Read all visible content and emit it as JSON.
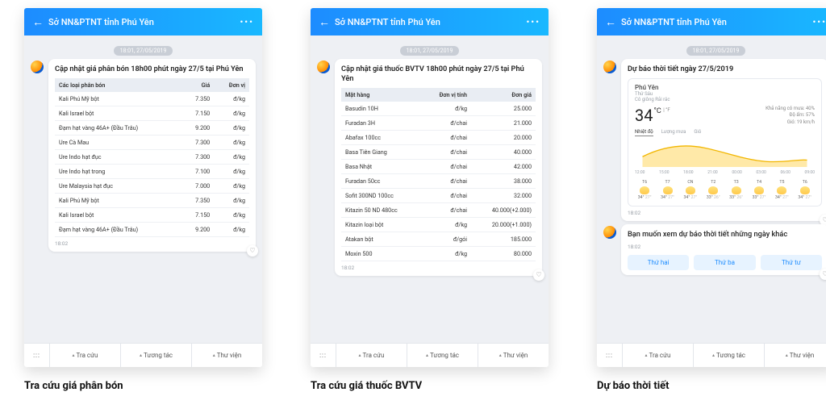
{
  "date_chip": "18:01, 27/05/2019",
  "header_title": "Sở NN&PTNT tỉnh Phú Yên",
  "bottom": {
    "kbd": ":::",
    "t1": "Tra cứu",
    "t2": "Tương tác",
    "t3": "Thư viện"
  },
  "p1": {
    "caption": "Tra cứu giá phân bón",
    "title": "Cập nhật giá phân bón 18h00 phút ngày 27/5 tại Phú Yên",
    "time": "18:02",
    "cols": [
      "Các loại phân bón",
      "Giá",
      "Đơn vị"
    ],
    "rows": [
      [
        "Kali Phú Mỹ bột",
        "7.350",
        "đ/kg"
      ],
      [
        "Kali Israel bột",
        "7.150",
        "đ/kg"
      ],
      [
        "Đạm hạt vàng 46A+ (Đầu Trâu)",
        "9.200",
        "đ/kg"
      ],
      [
        "Ure Cà Mau",
        "7.300",
        "đ/kg"
      ],
      [
        "Ure Indo hạt đục",
        "7.300",
        "đ/kg"
      ],
      [
        "Ure Indo hạt trong",
        "7.100",
        "đ/kg"
      ],
      [
        "Ure Malaysia hạt đục",
        "7.000",
        "đ/kg"
      ],
      [
        "Kali Phú Mỹ bột",
        "7.350",
        "đ/kg"
      ],
      [
        "Kali Israel bột",
        "7.150",
        "đ/kg"
      ],
      [
        "Đạm hạt vàng 46A+ (Đầu Trâu)",
        "9.200",
        "đ/kg"
      ]
    ]
  },
  "p2": {
    "caption": "Tra cứu giá thuốc BVTV",
    "title": "Cập nhật giá thuốc BVTV 18h00 phút ngày 27/5 tại Phú Yên",
    "time": "18:02",
    "cols": [
      "Mặt hàng",
      "Đơn vị tính",
      "Đơn giá"
    ],
    "rows": [
      [
        "Basudin 10H",
        "đ/kg",
        "25.000"
      ],
      [
        "Furadan 3H",
        "đ/chai",
        "21.000"
      ],
      [
        "Abafax 100cc",
        "đ/chai",
        "20.000"
      ],
      [
        "Basa Tiên Giang",
        "đ/chai",
        "40.000"
      ],
      [
        "Basa Nhật",
        "đ/chai",
        "42.000"
      ],
      [
        "Furadan 50cc",
        "đ/chai",
        "38.000"
      ],
      [
        "Sofit 300ND 100cc",
        "đ/chai",
        "32.000"
      ],
      [
        "Kitazin 50 ND 480cc",
        "đ/chai",
        "40.000(+2.000)"
      ],
      [
        "Kitazin loại bột",
        "đ/kg",
        "20.000(+1.000)"
      ],
      [
        "Atakan bột",
        "đ/gói",
        "185.000"
      ],
      [
        "Moxin 500",
        "đ/kg",
        "80.000"
      ]
    ]
  },
  "p3": {
    "caption": "Dự báo thời tiết",
    "title": "Dự báo thời tiết ngày 27/5/2019",
    "time1": "18:02",
    "time2": "18:02",
    "weather": {
      "loc": "Phú Yên",
      "dow": "Thứ Sáu",
      "cond": "Có giông Rải rác",
      "temp": "34",
      "unit_c": "°C",
      "unit_f": "°F",
      "meta1": "Khả năng có mưa: 40%",
      "meta2": "Độ ẩm: 57%",
      "meta3": "Gió: 19 km/h",
      "tabs": [
        "Nhiệt độ",
        "Lượng mưa",
        "Gió"
      ],
      "hours": [
        "12:00",
        "15:00",
        "18:00",
        "21:00",
        "00:00",
        "03:00",
        "06:00",
        "09:00"
      ],
      "days": [
        {
          "d": "T6",
          "hi": "34",
          "lo": "27"
        },
        {
          "d": "T7",
          "hi": "34",
          "lo": "27"
        },
        {
          "d": "CN",
          "hi": "34",
          "lo": "27"
        },
        {
          "d": "T2",
          "hi": "33",
          "lo": "26"
        },
        {
          "d": "T3",
          "hi": "33",
          "lo": "26"
        },
        {
          "d": "T4",
          "hi": "33",
          "lo": "27"
        },
        {
          "d": "T5",
          "hi": "34",
          "lo": "27"
        },
        {
          "d": "T6",
          "hi": "34",
          "lo": "27"
        }
      ]
    },
    "q_title": "Bạn muốn xem dự báo thời tiết những ngày khác",
    "chips": [
      "Thứ hai",
      "Thứ ba",
      "Thứ tư"
    ]
  }
}
